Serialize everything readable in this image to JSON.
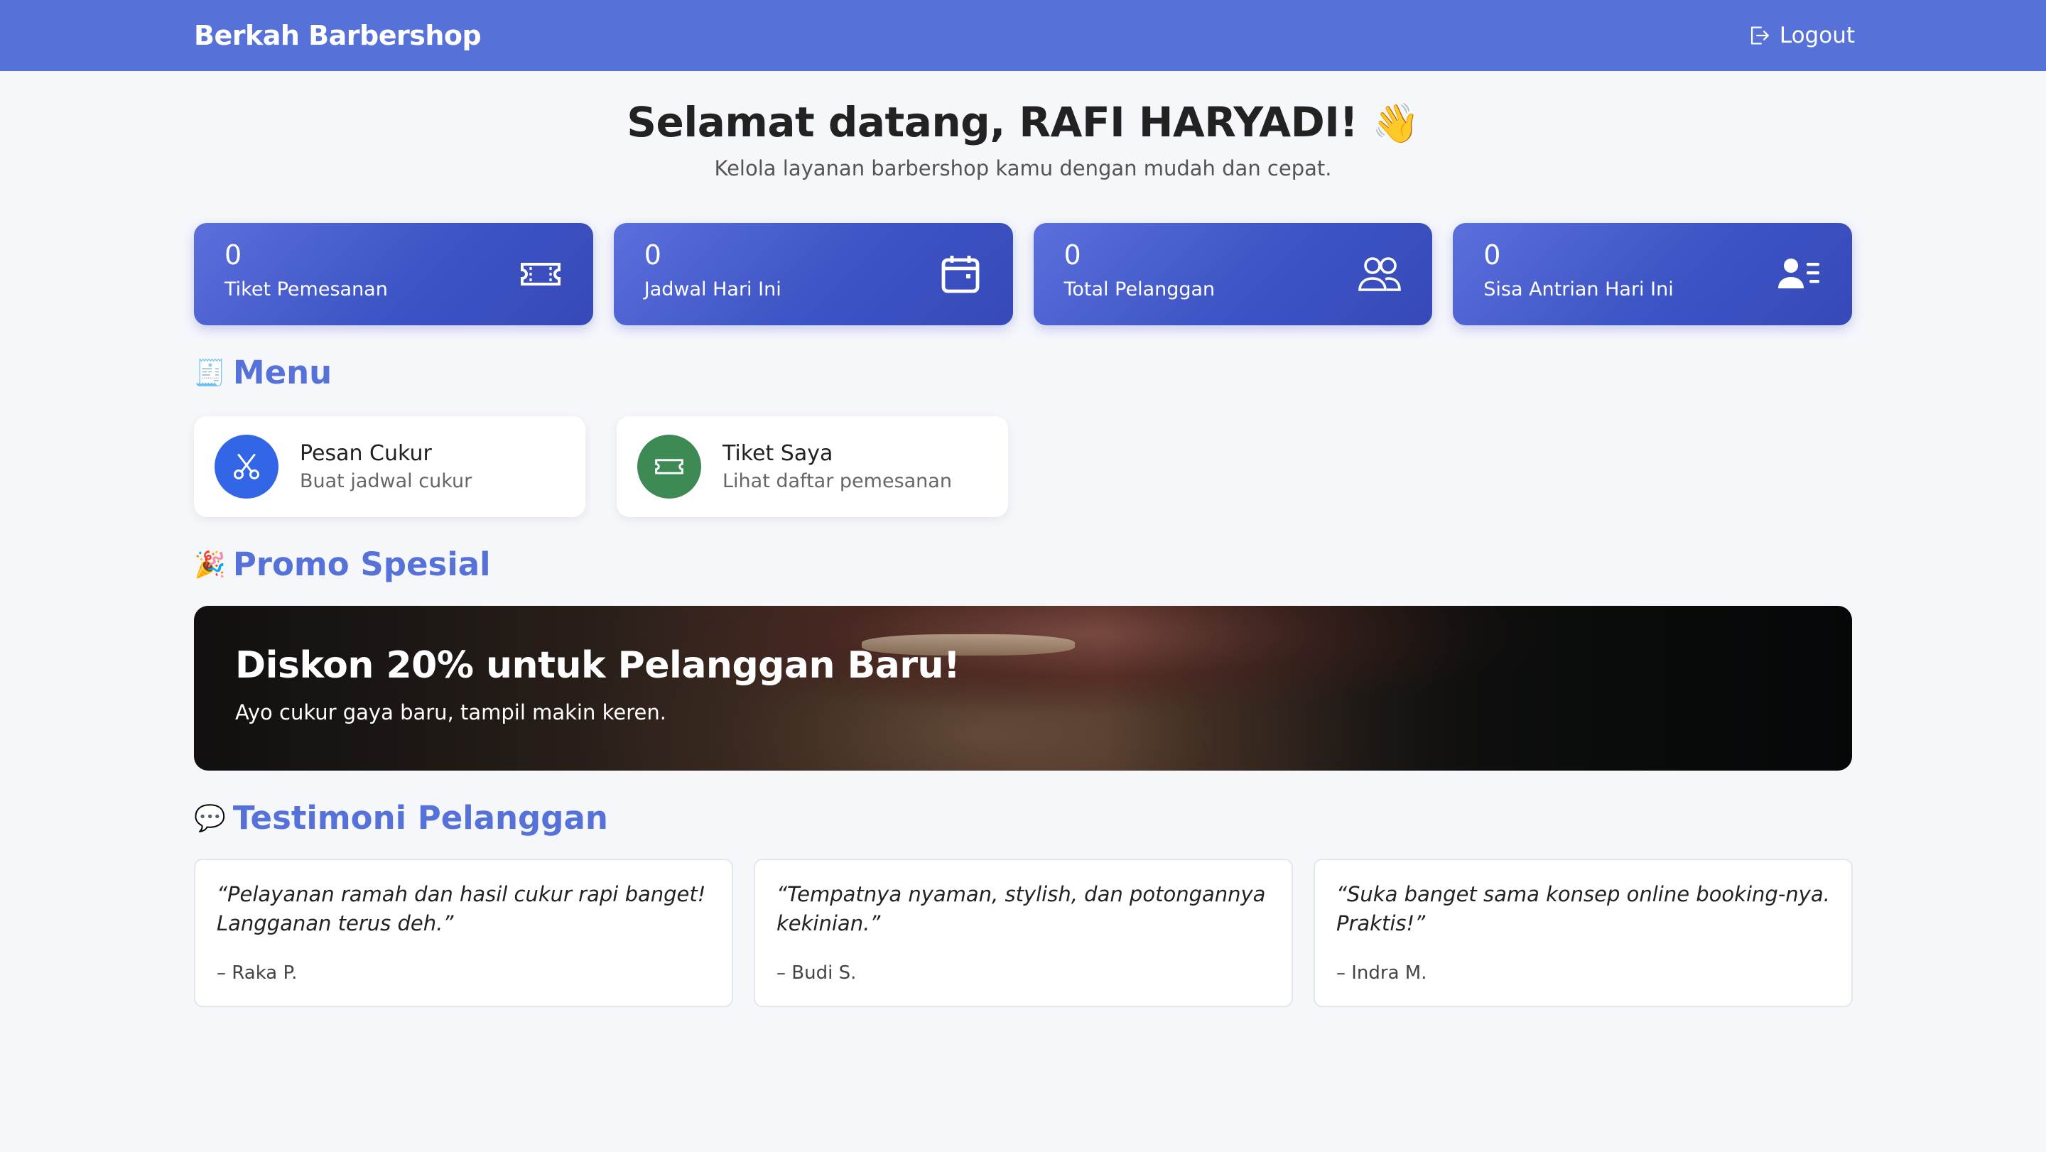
{
  "nav": {
    "brand": "Berkah Barbershop",
    "logout_label": "Logout"
  },
  "hero": {
    "title": "Selamat datang, RAFI HARYADI!",
    "emoji": "👋",
    "subtitle": "Kelola layanan barbershop kamu dengan mudah dan cepat."
  },
  "stats": [
    {
      "value": "0",
      "label": "Tiket Pemesanan",
      "icon": "ticket-icon"
    },
    {
      "value": "0",
      "label": "Jadwal Hari Ini",
      "icon": "calendar-icon"
    },
    {
      "value": "0",
      "label": "Total Pelanggan",
      "icon": "people-icon"
    },
    {
      "value": "0",
      "label": "Sisa Antrian Hari Ini",
      "icon": "person-lines-icon"
    }
  ],
  "menu": {
    "emoji": "🧾",
    "title": "Menu",
    "items": [
      {
        "title": "Pesan Cukur",
        "subtitle": "Buat jadwal cukur",
        "icon": "scissors-icon",
        "color": "#3366e6"
      },
      {
        "title": "Tiket Saya",
        "subtitle": "Lihat daftar pemesanan",
        "icon": "ticket-icon",
        "color": "#3d8a55"
      }
    ]
  },
  "promo": {
    "emoji": "🎉",
    "title": "Promo Spesial",
    "headline": "Diskon 20% untuk Pelanggan Baru!",
    "text": "Ayo cukur gaya baru, tampil makin keren."
  },
  "testimonials": {
    "emoji": "💬",
    "title": "Testimoni Pelanggan",
    "items": [
      {
        "quote": "“Pelayanan ramah dan hasil cukur rapi banget! Langganan terus deh.”",
        "author": "– Raka P."
      },
      {
        "quote": "“Tempatnya nyaman, stylish, dan potongannya kekinian.”",
        "author": "– Budi S."
      },
      {
        "quote": "“Suka banget sama konsep online booking-nya. Praktis!”",
        "author": "– Indra M."
      }
    ]
  },
  "colors": {
    "navbar": "#5672d8",
    "accent": "#5672d8",
    "stat_card": "#3f56c6",
    "background": "#f6f7fb"
  }
}
